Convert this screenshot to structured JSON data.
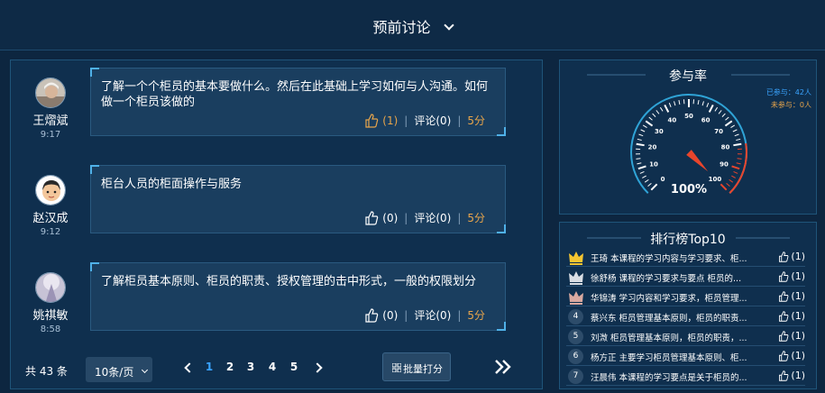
{
  "header": {
    "title": "预前讨论"
  },
  "posts": [
    {
      "user": "王熠斌",
      "time": "9:17",
      "text": "了解一个个柜员的基本要做什么。然后在此基础上学习如何与人沟通。如何做一个柜员该做的",
      "likes": "(1)",
      "comment": "评论(0)",
      "score": "5分"
    },
    {
      "user": "赵汉成",
      "time": "9:12",
      "text": "柜台人员的柜面操作与服务",
      "likes": "(0)",
      "comment": "评论(0)",
      "score": "5分"
    },
    {
      "user": "姚祺敏",
      "time": "8:58",
      "text": "了解柜员基本原则、柜员的职责、授权管理的击中形式，一般的权限划分",
      "likes": "(0)",
      "comment": "评论(0)",
      "score": "5分"
    }
  ],
  "pager": {
    "total": "共 43 条",
    "page_size": "10条/页",
    "pages": [
      "1",
      "2",
      "3",
      "4",
      "5"
    ],
    "active_page": "1",
    "batch": "批量打分"
  },
  "rate": {
    "title": "参与率",
    "joined": "已参与：42人",
    "not_joined": "未参与：0人",
    "value": "100%",
    "percent": 100,
    "ticks": [
      "0",
      "10",
      "20",
      "30",
      "40",
      "50",
      "60",
      "70",
      "80",
      "90",
      "100"
    ]
  },
  "rank": {
    "title": "排行榜Top10",
    "items": [
      {
        "rank": "1",
        "text": "王琦 本课程的学习内容与学习要求、柜...",
        "likes": "(1)"
      },
      {
        "rank": "2",
        "text": "徐舒杨 课程的学习要求与要点 柜员的...",
        "likes": "(1)"
      },
      {
        "rank": "3",
        "text": "华锦涛 学习内容和学习要求，柜员管理...",
        "likes": "(1)"
      },
      {
        "rank": "4",
        "text": "蔡兴东 柜员管理基本原则，柜员的职责...",
        "likes": "(1)"
      },
      {
        "rank": "5",
        "text": "刘溦 柜员管理基本原则，柜员的职责，...",
        "likes": "(1)"
      },
      {
        "rank": "6",
        "text": "杨方正 主要学习柜员管理基本原则、柜...",
        "likes": "(1)"
      },
      {
        "rank": "7",
        "text": "汪晨伟 本课程的学习要点是关于柜员的...",
        "likes": "(1)"
      }
    ]
  },
  "colors": {
    "accent": "#3aa4ff",
    "score": "#e8a54b",
    "needle": "#e8452c"
  }
}
